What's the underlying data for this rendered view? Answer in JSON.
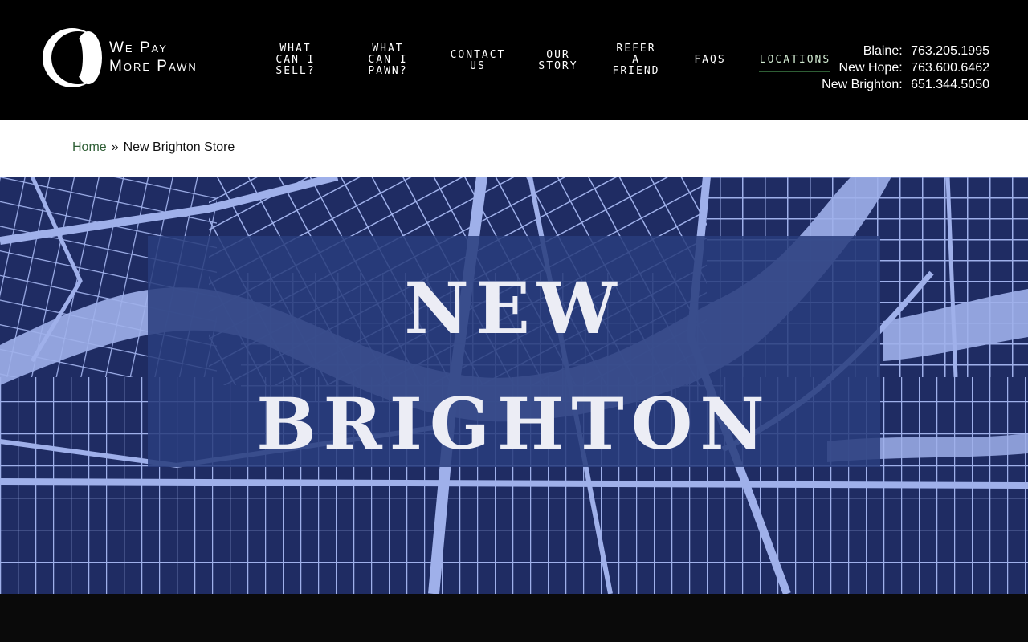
{
  "header": {
    "logo": {
      "line1": "We Pay",
      "line2": "More Pawn"
    },
    "nav": [
      {
        "label": "WHAT\nCAN I\nSELL?"
      },
      {
        "label": "WHAT\nCAN I\nPAWN?"
      },
      {
        "label": "CONTACT\nUS"
      },
      {
        "label": "OUR\nSTORY"
      },
      {
        "label": "REFER\nA\nFRIEND"
      },
      {
        "label": "FAQS"
      },
      {
        "label": "LOCATIONS",
        "active": true
      }
    ],
    "phones": [
      {
        "location": "Blaine:",
        "number": "763.205.1995"
      },
      {
        "location": "New Hope:",
        "number": "763.600.6462"
      },
      {
        "location": "New Brighton:",
        "number": "651.344.5050"
      }
    ]
  },
  "breadcrumb": {
    "home": "Home",
    "separator": "»",
    "current": "New Brighton Store"
  },
  "hero": {
    "title_line1": "NEW",
    "title_line2": "BRIGHTON"
  },
  "colors": {
    "header_bg": "#000000",
    "accent_green": "#2e5e35",
    "map_bg": "#1f2c63",
    "map_lines": "#9fb0ea",
    "title_box": "#293c7d"
  }
}
